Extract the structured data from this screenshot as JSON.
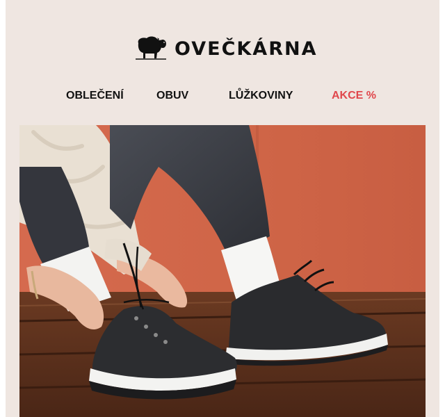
{
  "brand": {
    "name": "OVEČKÁRNA"
  },
  "nav": {
    "items": [
      {
        "label": "OBLEČENÍ"
      },
      {
        "label": "OBUV"
      },
      {
        "label": "LŮŽKOVINY"
      },
      {
        "label": "AKCE %"
      }
    ]
  },
  "colors": {
    "background": "#efe6e1",
    "text": "#111111",
    "sale": "#e0474c"
  },
  "hero": {
    "icon": "sneaker-lacing-photo"
  }
}
